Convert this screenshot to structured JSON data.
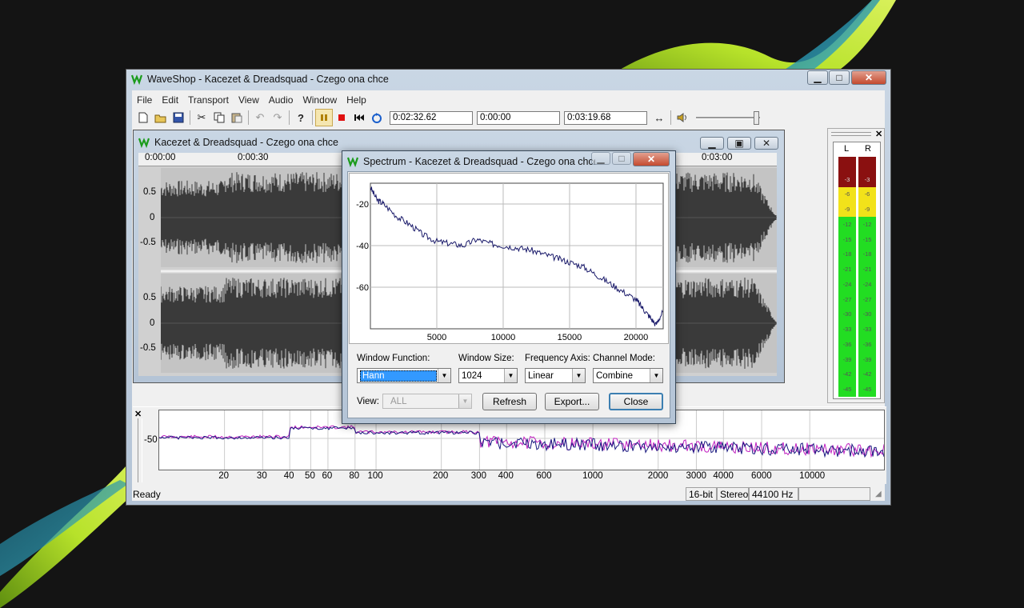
{
  "main_window": {
    "title": "WaveShop - Kacezet & Dreadsquad - Czego ona chce",
    "menu": [
      "File",
      "Edit",
      "Transport",
      "View",
      "Audio",
      "Window",
      "Help"
    ],
    "time_position": "0:02:32.62",
    "time_selection": "0:00:00",
    "time_length": "0:03:19.68"
  },
  "doc_window": {
    "title": "Kacezet & Dreadsquad - Czego ona chce",
    "ruler": [
      "0:00:00",
      "0:00:30",
      "0:03:00"
    ],
    "channel1_ticks": [
      "0.5",
      "0",
      "-0.5"
    ],
    "channel2_ticks": [
      "0.5",
      "0",
      "-0.5"
    ]
  },
  "spectrum_dialog": {
    "title": "Spectrum - Kacezet & Dreadsquad - Czego ona chce",
    "chart_data": {
      "type": "line",
      "yticks": [
        "-20",
        "-40",
        "-60"
      ],
      "xticks": [
        "5000",
        "10000",
        "15000",
        "20000"
      ],
      "ylim": [
        -80,
        -10
      ],
      "xlim": [
        0,
        22050
      ],
      "x": [
        0,
        500,
        1000,
        2000,
        3000,
        4000,
        5000,
        6000,
        7000,
        8000,
        9000,
        10000,
        11000,
        12000,
        13000,
        14000,
        15000,
        16000,
        17000,
        18000,
        19000,
        20000,
        20500,
        21000,
        21500,
        22000
      ],
      "y": [
        -12,
        -18,
        -20,
        -26,
        -30,
        -35,
        -38,
        -39,
        -40,
        -37,
        -39,
        -40,
        -41,
        -42,
        -44,
        -46,
        -48,
        -50,
        -54,
        -58,
        -62,
        -66,
        -70,
        -74,
        -78,
        -72
      ]
    },
    "window_function_label": "Window Function:",
    "window_function_value": "Hann",
    "window_size_label": "Window Size:",
    "window_size_value": "1024",
    "frequency_axis_label": "Frequency Axis:",
    "frequency_axis_value": "Linear",
    "channel_mode_label": "Channel Mode:",
    "channel_mode_value": "Combine",
    "view_label": "View:",
    "view_value": "ALL",
    "refresh_button": "Refresh",
    "export_button": "Export...",
    "close_button": "Close"
  },
  "spectrum_bar": {
    "ytick": "-50",
    "xticks": [
      "20",
      "30",
      "40",
      "50",
      "60",
      "80",
      "100",
      "200",
      "300",
      "400",
      "600",
      "1000",
      "2000",
      "3000",
      "4000",
      "6000",
      "10000"
    ],
    "xvalues": [
      20,
      30,
      40,
      50,
      60,
      80,
      100,
      200,
      300,
      400,
      600,
      1000,
      2000,
      3000,
      4000,
      6000,
      10000
    ]
  },
  "meters": {
    "labels": [
      "L",
      "R"
    ],
    "scale": [
      "-3",
      "-6",
      "-9",
      "-12",
      "-15",
      "-18",
      "-21",
      "-24",
      "-27",
      "-30",
      "-33",
      "-36",
      "-39",
      "-42",
      "-45"
    ]
  },
  "statusbar": {
    "text": "Ready",
    "bits": "16-bit",
    "channels": "Stereo",
    "rate": "44100 Hz"
  }
}
